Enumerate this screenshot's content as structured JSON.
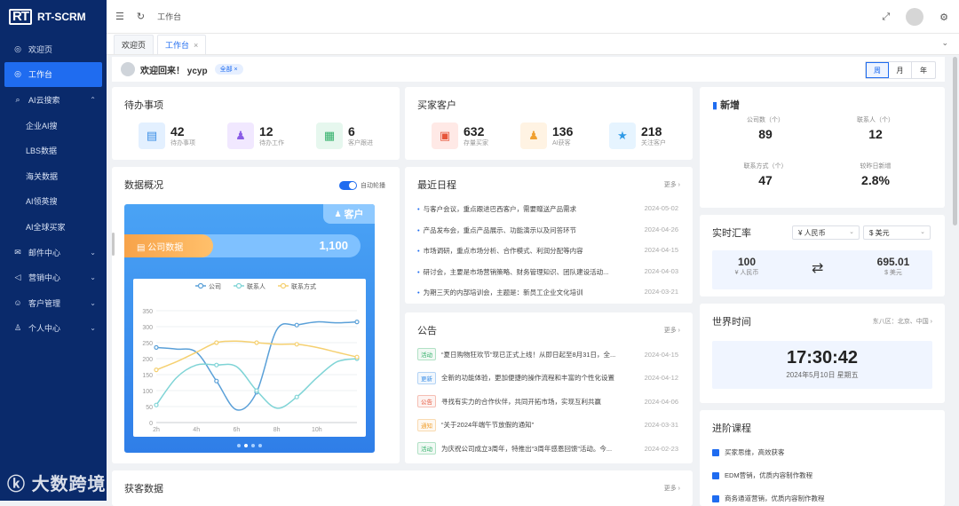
{
  "brand": {
    "mark": "RT",
    "name": "RT-SCRM"
  },
  "sidebar": {
    "items": [
      {
        "label": "欢迎页",
        "icon": "dashboard-icon"
      },
      {
        "label": "工作台",
        "icon": "dashboard-icon"
      },
      {
        "label": "AI云搜索",
        "icon": "search-icon"
      },
      {
        "label": "企业AI搜"
      },
      {
        "label": "LBS数据"
      },
      {
        "label": "海关数据"
      },
      {
        "label": "AI领英搜"
      },
      {
        "label": "AI全球买家"
      },
      {
        "label": "邮件中心",
        "icon": "mail-icon"
      },
      {
        "label": "营销中心",
        "icon": "megaphone-icon"
      },
      {
        "label": "客户管理",
        "icon": "customer-icon"
      },
      {
        "label": "个人中心",
        "icon": "person-icon"
      }
    ]
  },
  "watermark": "大数跨境",
  "header": {
    "breadcrumb": "工作台"
  },
  "tabs": [
    {
      "label": "欢迎页"
    },
    {
      "label": "工作台"
    }
  ],
  "welcome": {
    "text": "欢迎回来！ ycyp",
    "pill": "全部 ×",
    "periods": [
      "周",
      "月",
      "年"
    ],
    "avatar": "ycyp"
  },
  "todo": {
    "title": "待办事项",
    "stats": [
      {
        "value": "42",
        "label": "待办事项",
        "color": "#e3f0ff",
        "fg": "#3a8ee6"
      },
      {
        "value": "12",
        "label": "待办工作",
        "color": "#f1e8ff",
        "fg": "#8a5ce6"
      },
      {
        "value": "6",
        "label": "客户跟进",
        "color": "#e6f7ee",
        "fg": "#32b06a"
      }
    ]
  },
  "buyers": {
    "title": "买家客户",
    "stats": [
      {
        "value": "632",
        "label": "存量买家",
        "color": "#ffe9e6",
        "fg": "#e6553a"
      },
      {
        "value": "136",
        "label": "AI获客",
        "color": "#fff3e3",
        "fg": "#f0a030"
      },
      {
        "value": "218",
        "label": "关注客户",
        "color": "#e6f4ff",
        "fg": "#2f9ae6"
      }
    ]
  },
  "newstats": {
    "title": "新增",
    "items": [
      {
        "label": "公司数（个）",
        "value": "89"
      },
      {
        "label": "联系人（个）",
        "value": "12"
      },
      {
        "label": "联系方式（个）",
        "value": "47"
      },
      {
        "label": "较昨日新增",
        "value": "2.8%"
      }
    ]
  },
  "overview": {
    "title": "数据概况",
    "toggle_label": "自动轮播",
    "tag": "客户",
    "kpi_label": "公司数据",
    "kpi_value": "1,100"
  },
  "chart_data": {
    "type": "line",
    "categories": [
      "2h",
      "4h",
      "6h",
      "8h",
      "10h"
    ],
    "x": [
      1,
      2,
      3,
      4,
      5,
      6,
      7,
      8,
      9,
      10,
      11
    ],
    "series": [
      {
        "name": "公司",
        "color": "#5aa0d8",
        "values": [
          235,
          230,
          220,
          130,
          40,
          95,
          290,
          305,
          315,
          312,
          315
        ]
      },
      {
        "name": "联系人",
        "color": "#7fd4d6",
        "values": [
          55,
          140,
          180,
          180,
          175,
          100,
          45,
          80,
          140,
          190,
          200
        ]
      },
      {
        "name": "联系方式",
        "color": "#f5d070",
        "values": [
          165,
          190,
          220,
          250,
          255,
          250,
          245,
          245,
          235,
          220,
          205
        ]
      }
    ],
    "yticks": [
      0,
      50,
      100,
      150,
      200,
      250,
      300,
      350
    ],
    "ylim": [
      0,
      350
    ],
    "xtick_positions": [
      1,
      3,
      5,
      7,
      9
    ],
    "xtick_labels": [
      "2h",
      "4h",
      "6h",
      "8h",
      "10h"
    ],
    "legend": "top"
  },
  "schedule": {
    "title": "最近日程",
    "more": "更多 ›",
    "items": [
      {
        "text": "与客户会议，重点跟进巴西客户，需要赠送产品需求",
        "date": "2024-05-02"
      },
      {
        "text": "产品发布会，重点产品展示、功能演示以及问答环节",
        "date": "2024-04-26"
      },
      {
        "text": "市场调研，重点市场分析、合作模式、利润分配等内容",
        "date": "2024-04-15"
      },
      {
        "text": "研讨会，主要是市场营销策略、财务管理知识、团队建设活动...",
        "date": "2024-04-03"
      },
      {
        "text": "为期三天的内部培训会，主题是：新员工企业文化培训",
        "date": "2024-03-21"
      }
    ]
  },
  "notices": {
    "title": "公告",
    "more": "更多 ›",
    "items": [
      {
        "tag": "活动",
        "tag_color": "#32b06a",
        "text": "“夏日购物狂欢节”现已正式上线！从即日起至8月31日，全...",
        "date": "2024-04-15"
      },
      {
        "tag": "更新",
        "tag_color": "#3a8ee6",
        "text": "全新的功能体验，更加便捷的操作流程和丰富的个性化设置",
        "date": "2024-04-12"
      },
      {
        "tag": "公告",
        "tag_color": "#e6553a",
        "text": "寻找有实力的合作伙伴，共同开拓市场，实现互利共赢",
        "date": "2024-04-06"
      },
      {
        "tag": "通知",
        "tag_color": "#f0a030",
        "text": "“关于2024年端午节放假的通知”",
        "date": "2024-03-31"
      },
      {
        "tag": "活动",
        "tag_color": "#32b06a",
        "text": "为庆祝公司成立3周年，特推出“3周年感恩回馈”活动。今...",
        "date": "2024-02-23"
      }
    ]
  },
  "acquire": {
    "title": "获客数据",
    "more": "更多 ›"
  },
  "fx": {
    "title": "实时汇率",
    "from": "¥ 人民币",
    "to": "$ 美元",
    "from_amount": "100",
    "from_unit": "¥ 人民币",
    "to_amount": "695.01",
    "to_unit": "$ 美元"
  },
  "worldtime": {
    "title": "世界时间",
    "zone": "东八区：北京、中国 ›",
    "time": "17:30:42",
    "date": "2024年5月10日 星期五"
  },
  "courses": {
    "title": "进阶课程",
    "items": [
      {
        "text": "买家思维，高效获客"
      },
      {
        "text": "EDM营销，优质内容制作教程"
      },
      {
        "text": "商务通道营销，优质内容制作教程"
      }
    ]
  }
}
